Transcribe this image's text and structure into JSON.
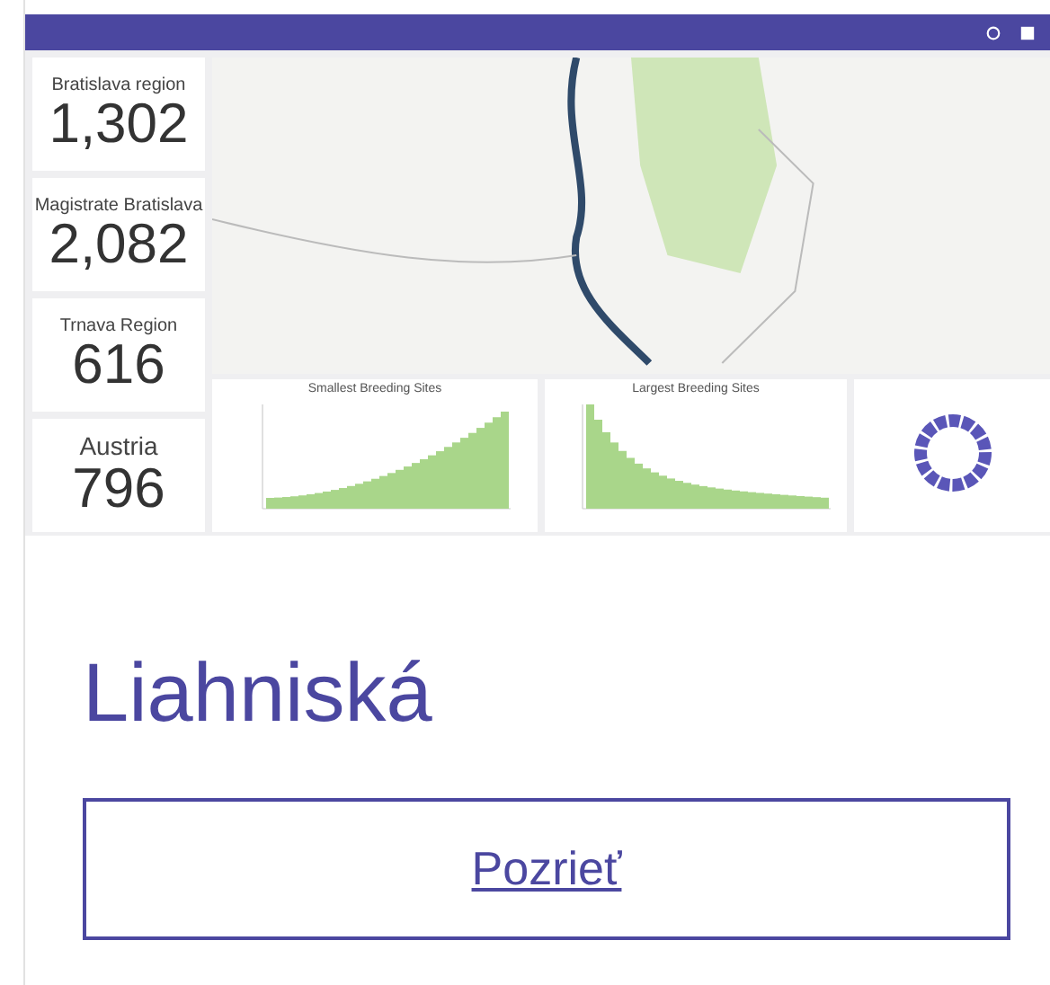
{
  "dashboard": {
    "stats": [
      {
        "label": "Bratislava region",
        "value": "1,302"
      },
      {
        "label": "Magistrate Bratislava",
        "value": "2,082"
      },
      {
        "label": "Trnava Region",
        "value": "616"
      },
      {
        "label": "Austria",
        "value": "796"
      }
    ],
    "charts": [
      {
        "kind": "ascending",
        "title": "Smallest Breeding Sites"
      },
      {
        "kind": "descending",
        "title": "Largest Breeding Sites"
      },
      {
        "kind": "donut"
      }
    ]
  },
  "card": {
    "title": "Liahniská",
    "link": "Pozrieť"
  }
}
